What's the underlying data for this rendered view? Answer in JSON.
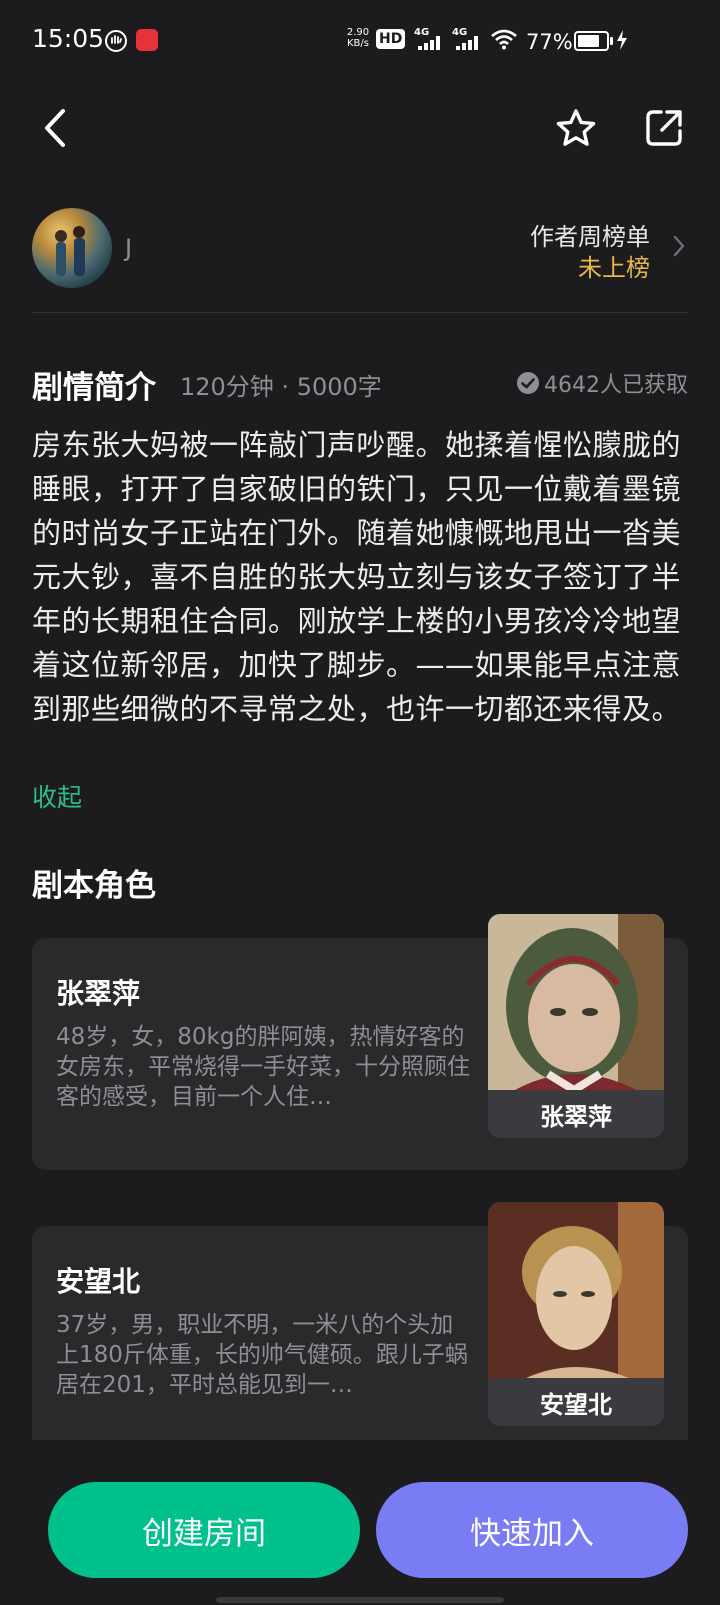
{
  "status_bar": {
    "time": "15:05",
    "net_speed_top": "2.90",
    "net_speed_unit": "KB/s",
    "hd": "HD",
    "sim1": "4G",
    "sim2": "4G",
    "battery": "77%",
    "battery_level": 0.77
  },
  "header": {
    "back_icon": "chevron-left-icon",
    "favorite_icon": "star-outline-icon",
    "share_icon": "external-share-icon"
  },
  "author": {
    "name": "J",
    "rank_title": "作者周榜单",
    "rank_value": "未上榜"
  },
  "synopsis": {
    "title": "剧情简介",
    "meta": "120分钟 · 5000字",
    "obtained": "4642人已获取",
    "text": "房东张大妈被一阵敲门声吵醒。她揉着惺忪朦胧的睡眼，打开了自家破旧的铁门，只见一位戴着墨镜的时尚女子正站在门外。随着她慷慨地甩出一沓美元大钞，喜不自胜的张大妈立刻与该女子签订了半年的长期租住合同。刚放学上楼的小男孩冷冷地望着这位新邻居，加快了脚步。——如果能早点注意到那些细微的不寻常之处，也许一切都还来得及。",
    "collapse_label": "收起"
  },
  "roles": {
    "title": "剧本角色",
    "items": [
      {
        "name": "张翠萍",
        "desc": "48岁，女，80kg的胖阿姨，热情好客的女房东，平常烧得一手好菜，十分照顾住客的感受，目前一个人住…",
        "portrait_label": "张翠萍"
      },
      {
        "name": "安望北",
        "desc": "37岁，男，职业不明，一米八的个头加上180斤体重，长的帅气健硕。跟儿子蜗居在201，平时总能见到一…",
        "portrait_label": "安望北"
      }
    ]
  },
  "actions": {
    "create_room": "创建房间",
    "quick_join": "快速加入",
    "create_color": "#00c08b",
    "join_color": "#7a7cf4"
  }
}
